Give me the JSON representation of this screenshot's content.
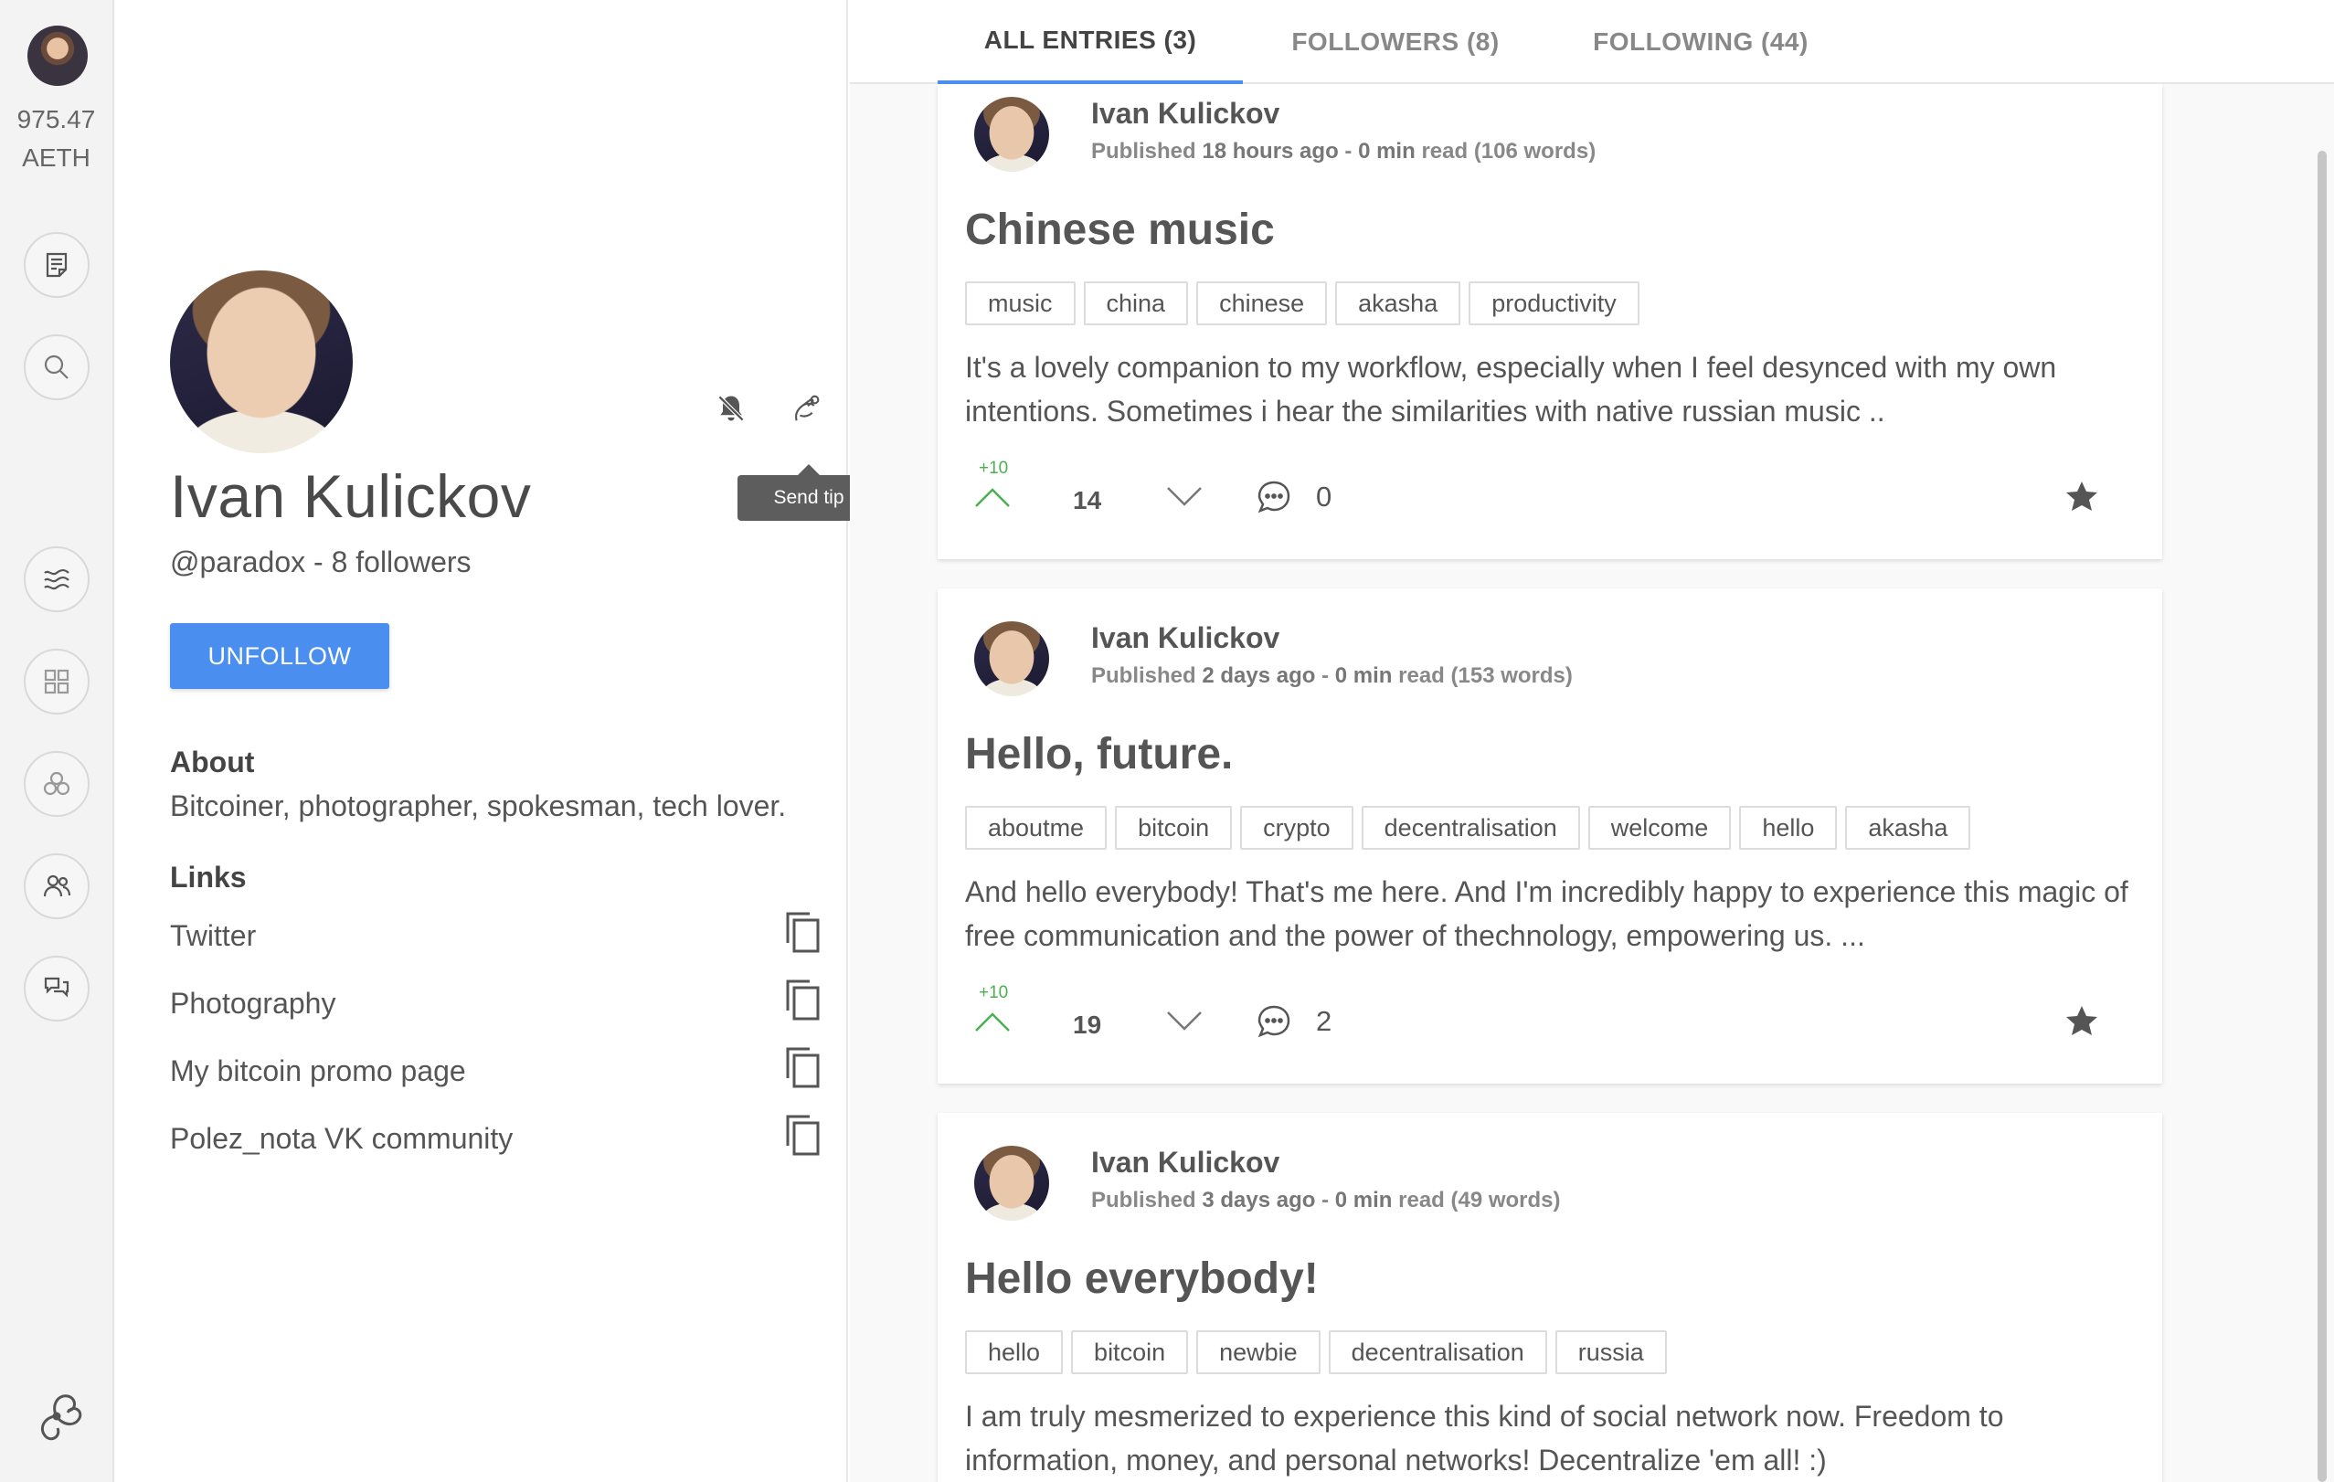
{
  "rail": {
    "balance_amount": "975.47",
    "balance_unit": "AETH",
    "buttons": [
      "new-entry-icon",
      "search-icon",
      "stream-icon",
      "apps-icon",
      "communities-icon",
      "people-icon",
      "chat-icon"
    ]
  },
  "profile": {
    "name": "Ivan Kulickov",
    "handle_line": "@paradox - 8 followers",
    "unfollow_label": "UNFOLLOW",
    "tooltip": "Send tip",
    "about_title": "About",
    "about_text": "Bitcoiner, photographer, spokesman, tech lover.",
    "links_title": "Links",
    "links": [
      {
        "label": "Twitter"
      },
      {
        "label": "Photography"
      },
      {
        "label": "My bitcoin promo page"
      },
      {
        "label": "Polez_nota VK community"
      }
    ]
  },
  "tabs": [
    {
      "label": "ALL ENTRIES (3)",
      "active": true
    },
    {
      "label": "FOLLOWERS (8)",
      "active": false
    },
    {
      "label": "FOLLOWING (44)",
      "active": false
    }
  ],
  "entries": [
    {
      "author": "Ivan Kulickov",
      "published_label": "Published",
      "published_when": "18 hours ago",
      "sep": "-",
      "read_time": "0 min",
      "read_label": "read",
      "words": "(106 words)",
      "title": "Chinese music",
      "tags": [
        "music",
        "china",
        "chinese",
        "akasha",
        "productivity"
      ],
      "excerpt": "It's a lovely companion to my workflow, especially when I feel desynced with my own intentions. Sometimes i hear the similarities with native russian music ..",
      "vote_bonus": "+10",
      "score": "14",
      "comments": "0"
    },
    {
      "author": "Ivan Kulickov",
      "published_label": "Published",
      "published_when": "2 days ago",
      "sep": "-",
      "read_time": "0 min",
      "read_label": "read",
      "words": "(153 words)",
      "title": "Hello, future.",
      "tags": [
        "aboutme",
        "bitcoin",
        "crypto",
        "decentralisation",
        "welcome",
        "hello",
        "akasha"
      ],
      "excerpt": "And hello everybody! That's me here. And I'm incredibly happy to experience this magic of free communication and the power of thechnology, empowering us. ...",
      "vote_bonus": "+10",
      "score": "19",
      "comments": "2"
    },
    {
      "author": "Ivan Kulickov",
      "published_label": "Published",
      "published_when": "3 days ago",
      "sep": "-",
      "read_time": "0 min",
      "read_label": "read",
      "words": "(49 words)",
      "title": "Hello everybody!",
      "tags": [
        "hello",
        "bitcoin",
        "newbie",
        "decentralisation",
        "russia"
      ],
      "excerpt": "I am truly mesmerized to experience this kind of social network now. Freedom to information, money, and personal networks! Decentralize 'em all! :)",
      "vote_bonus": "",
      "score": "",
      "comments": ""
    }
  ],
  "colors": {
    "accent": "#4a8ff0",
    "vote_bonus": "#4caf50",
    "tooltip_bg": "#5d5d5d"
  }
}
